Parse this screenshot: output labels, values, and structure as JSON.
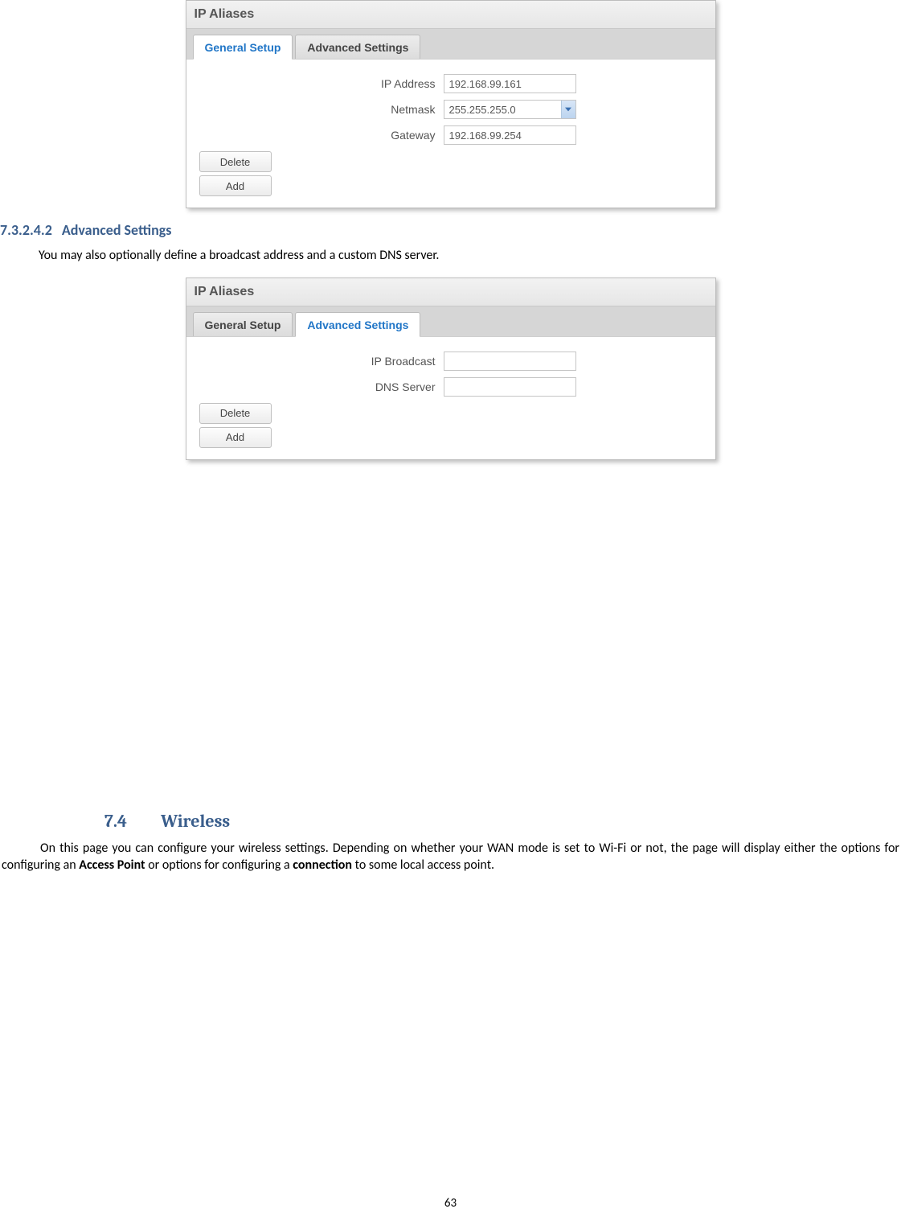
{
  "panel1": {
    "title": "IP Aliases",
    "tabs": {
      "general": "General Setup",
      "advanced": "Advanced Settings"
    },
    "fields": {
      "ip_label": "IP Address",
      "ip_value": "192.168.99.161",
      "netmask_label": "Netmask",
      "netmask_value": "255.255.255.0",
      "gateway_label": "Gateway",
      "gateway_value": "192.168.99.254"
    },
    "delete_label": "Delete",
    "add_label": "Add"
  },
  "section_adv": {
    "num": "7.3.2.4.2",
    "title": "Advanced Settings",
    "para": "You may also optionally define a broadcast address and a custom DNS server."
  },
  "panel2": {
    "title": "IP Aliases",
    "tabs": {
      "general": "General Setup",
      "advanced": "Advanced Settings"
    },
    "fields": {
      "broadcast_label": "IP Broadcast",
      "dns_label": "DNS Server"
    },
    "delete_label": "Delete",
    "add_label": "Add"
  },
  "section_wireless": {
    "num": "7.4",
    "title": "Wireless",
    "para_pre": "On this page you can configure your wireless settings. Depending on whether your WAN mode is set to Wi-Fi or not, the page will display either the options for configuring an ",
    "bold1": "Access Point",
    "para_mid": " or options for configuring a ",
    "bold2": "connection",
    "para_post": " to some local access point."
  },
  "page_number": "63"
}
